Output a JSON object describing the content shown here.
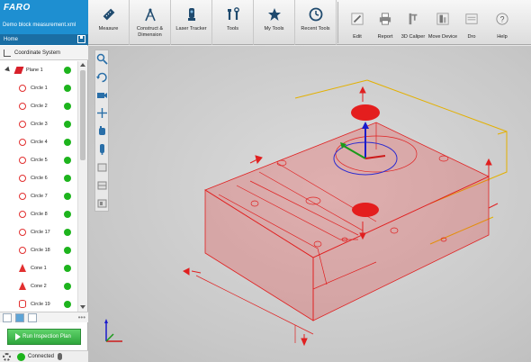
{
  "app": {
    "logo": "FARO",
    "document_name": "Demo block measurement.xml",
    "home_label": "Home",
    "coordinate_system_label": "Coordinate System"
  },
  "ribbon": {
    "buttons": [
      {
        "label": "Measure",
        "icon": "ruler-icon"
      },
      {
        "label": "Construct &\nDimension",
        "icon": "compass-icon"
      },
      {
        "label": "Laser Tracker",
        "icon": "tracker-icon"
      },
      {
        "label": "Tools",
        "icon": "tools-icon"
      },
      {
        "label": "My Tools",
        "icon": "star-icon"
      },
      {
        "label": "Recent Tools",
        "icon": "clock-icon"
      },
      {
        "label": "Edit",
        "icon": "pencil-icon"
      },
      {
        "label": "Report",
        "icon": "printer-icon"
      },
      {
        "label": "3D Caliper",
        "icon": "caliper-icon"
      },
      {
        "label": "Move Device",
        "icon": "move-device-icon"
      },
      {
        "label": "Dro",
        "icon": "dro-icon"
      },
      {
        "label": "Help",
        "icon": "help-icon"
      }
    ]
  },
  "tree": {
    "items": [
      {
        "label": "Plane 1",
        "type": "plane",
        "status": "ok"
      },
      {
        "label": "Circle 1",
        "type": "circle",
        "status": "ok"
      },
      {
        "label": "Circle 2",
        "type": "circle",
        "status": "ok"
      },
      {
        "label": "Circle 3",
        "type": "circle",
        "status": "ok"
      },
      {
        "label": "Circle 4",
        "type": "circle",
        "status": "ok"
      },
      {
        "label": "Circle 5",
        "type": "circle",
        "status": "ok"
      },
      {
        "label": "Circle 6",
        "type": "circle",
        "status": "ok"
      },
      {
        "label": "Circle 7",
        "type": "circle",
        "status": "ok"
      },
      {
        "label": "Circle 8",
        "type": "circle",
        "status": "ok"
      },
      {
        "label": "Circle 17",
        "type": "circle",
        "status": "ok"
      },
      {
        "label": "Circle 18",
        "type": "circle",
        "status": "ok"
      },
      {
        "label": "Cone 1",
        "type": "cone",
        "status": "ok"
      },
      {
        "label": "Cone 2",
        "type": "cone",
        "status": "ok"
      },
      {
        "label": "Circle 19",
        "type": "cylinder",
        "status": "ok"
      }
    ]
  },
  "footer": {
    "run_button_label": "Run Inspection Plan",
    "connection_status": "Connected"
  },
  "colors": {
    "brand_blue": "#1e8fd1",
    "status_ok": "#1db41d",
    "feature_red": "#e23030",
    "run_green": "#2ea63c"
  }
}
